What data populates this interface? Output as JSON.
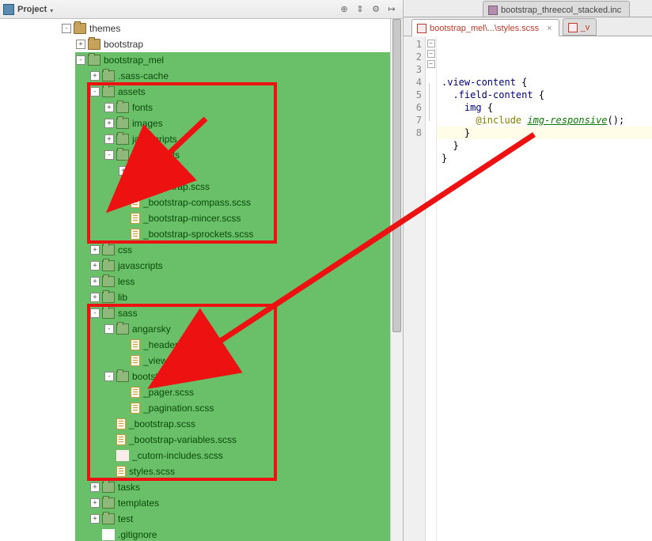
{
  "project_panel": {
    "title": "Project",
    "toolbar": [
      "target",
      "arrows",
      "gear",
      "hide"
    ]
  },
  "tree": [
    {
      "d": 4,
      "t": "-",
      "i": "folder",
      "l": "themes",
      "hl": false
    },
    {
      "d": 5,
      "t": "+",
      "i": "folder",
      "l": "bootstrap",
      "hl": false
    },
    {
      "d": 5,
      "t": "-",
      "i": "folder-green",
      "l": "bootstrap_mel",
      "hl": true
    },
    {
      "d": 6,
      "t": "+",
      "i": "folder-green",
      "l": ".sass-cache",
      "hl": true
    },
    {
      "d": 6,
      "t": "-",
      "i": "folder-green",
      "l": "assets",
      "hl": true,
      "box": 1
    },
    {
      "d": 7,
      "t": "+",
      "i": "folder-green",
      "l": "fonts",
      "hl": true,
      "box": 1
    },
    {
      "d": 7,
      "t": "+",
      "i": "folder-green",
      "l": "images",
      "hl": true,
      "box": 1
    },
    {
      "d": 7,
      "t": "+",
      "i": "folder-green",
      "l": "javascripts",
      "hl": true,
      "box": 1
    },
    {
      "d": 7,
      "t": "-",
      "i": "folder-green",
      "l": "stylesheets",
      "hl": true,
      "box": 1
    },
    {
      "d": 8,
      "t": "+",
      "i": "folder-green",
      "l": "bootstrap",
      "hl": true,
      "box": 1
    },
    {
      "d": 8,
      "t": " ",
      "i": "file",
      "l": "_bootstrap.scss",
      "hl": true,
      "box": 1
    },
    {
      "d": 8,
      "t": " ",
      "i": "file",
      "l": "_bootstrap-compass.scss",
      "hl": true,
      "box": 1
    },
    {
      "d": 8,
      "t": " ",
      "i": "file",
      "l": "_bootstrap-mincer.scss",
      "hl": true,
      "box": 1
    },
    {
      "d": 8,
      "t": " ",
      "i": "file",
      "l": "_bootstrap-sprockets.scss",
      "hl": true,
      "box": 1
    },
    {
      "d": 6,
      "t": "+",
      "i": "folder-green",
      "l": "css",
      "hl": true
    },
    {
      "d": 6,
      "t": "+",
      "i": "folder-green",
      "l": "javascripts",
      "hl": true
    },
    {
      "d": 6,
      "t": "+",
      "i": "folder-green",
      "l": "less",
      "hl": true
    },
    {
      "d": 6,
      "t": "+",
      "i": "folder-green",
      "l": "lib",
      "hl": true
    },
    {
      "d": 6,
      "t": "-",
      "i": "folder-green",
      "l": "sass",
      "hl": true,
      "box": 2
    },
    {
      "d": 7,
      "t": "-",
      "i": "folder-green",
      "l": "angarsky",
      "hl": true,
      "box": 2
    },
    {
      "d": 8,
      "t": " ",
      "i": "file",
      "l": "_header.scss",
      "hl": true,
      "box": 2
    },
    {
      "d": 8,
      "t": " ",
      "i": "file",
      "l": "_views.scss",
      "hl": true,
      "box": 2
    },
    {
      "d": 7,
      "t": "-",
      "i": "folder-green",
      "l": "bootstrap",
      "hl": true,
      "box": 2
    },
    {
      "d": 8,
      "t": " ",
      "i": "file",
      "l": "_pager.scss",
      "hl": true,
      "box": 2
    },
    {
      "d": 8,
      "t": " ",
      "i": "file",
      "l": "_pagination.scss",
      "hl": true,
      "box": 2
    },
    {
      "d": 7,
      "t": " ",
      "i": "file",
      "l": "_bootstrap.scss",
      "hl": true,
      "box": 2
    },
    {
      "d": 7,
      "t": " ",
      "i": "file",
      "l": "_bootstrap-variables.scss",
      "hl": true,
      "box": 2
    },
    {
      "d": 7,
      "t": " ",
      "i": "file-red",
      "l": "_cutom-includes.scss",
      "hl": true,
      "box": 2
    },
    {
      "d": 7,
      "t": " ",
      "i": "file",
      "l": "styles.scss",
      "hl": true,
      "box": 2
    },
    {
      "d": 6,
      "t": "+",
      "i": "folder-green",
      "l": "tasks",
      "hl": true
    },
    {
      "d": 6,
      "t": "+",
      "i": "folder-green",
      "l": "templates",
      "hl": true
    },
    {
      "d": 6,
      "t": "+",
      "i": "folder-green",
      "l": "test",
      "hl": true
    },
    {
      "d": 6,
      "t": " ",
      "i": "file-txt",
      "l": ".gitignore",
      "hl": true
    }
  ],
  "top_tab": {
    "label": "bootstrap_threecol_stacked.inc"
  },
  "editor_tabs": [
    {
      "label": "bootstrap_mel\\...\\styles.scss",
      "active": true,
      "modified": true,
      "icon": "scss-icon"
    },
    {
      "label": "_v",
      "active": false,
      "modified": true,
      "icon": "scss-icon"
    }
  ],
  "code": {
    "lines": [
      ".view-content {",
      "  .field-content {",
      "    img {",
      "      @include img-responsive();",
      "    }",
      "  }",
      "}",
      ""
    ],
    "line_numbers": [
      "1",
      "2",
      "3",
      "4",
      "5",
      "6",
      "7",
      "8"
    ],
    "highlight_line": 8
  }
}
